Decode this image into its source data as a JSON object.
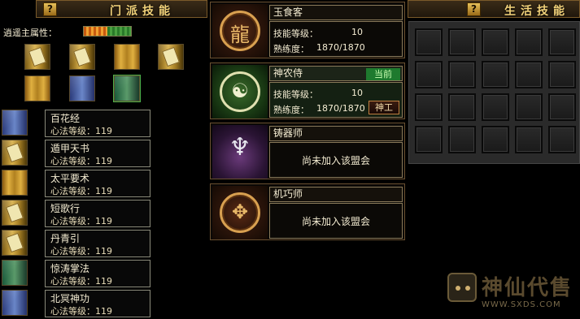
{
  "left_panel": {
    "help_label": "?",
    "title": "门派技能",
    "attribute_label": "逍遥主属性：",
    "skills": [
      {
        "name": "百花经",
        "level": "心法等级：119"
      },
      {
        "name": "遁甲天书",
        "level": "心法等级：119"
      },
      {
        "name": "太平要术",
        "level": "心法等级：119"
      },
      {
        "name": "短歌行",
        "level": "心法等级：119"
      },
      {
        "name": "丹青引",
        "level": "心法等级：119"
      },
      {
        "name": "惊涛掌法",
        "level": "心法等级：119"
      },
      {
        "name": "北冥神功",
        "level": "心法等级：119"
      }
    ]
  },
  "professions": [
    {
      "name": "玉食客",
      "skill_label": "技能等级：",
      "skill_value": "10",
      "prof_label": "熟练度：",
      "prof_value": "1870/1870",
      "icon": "chef-emblem-icon"
    },
    {
      "name": "神农侍",
      "badge": "当前",
      "skill_label": "技能等级：",
      "skill_value": "10",
      "prof_label": "熟练度：",
      "prof_value": "1870/1870",
      "button": "神工",
      "icon": "herbalist-emblem-icon"
    },
    {
      "name": "铸器师",
      "note": "尚未加入该盟会",
      "icon": "forge-emblem-icon"
    },
    {
      "name": "机巧师",
      "note": "尚未加入该盟会",
      "icon": "mechanist-emblem-icon"
    }
  ],
  "right_panel": {
    "help_label": "?",
    "title": "生活技能"
  },
  "watermark": {
    "title": "神仙代售",
    "url": "WWW.SXDS.COM"
  }
}
